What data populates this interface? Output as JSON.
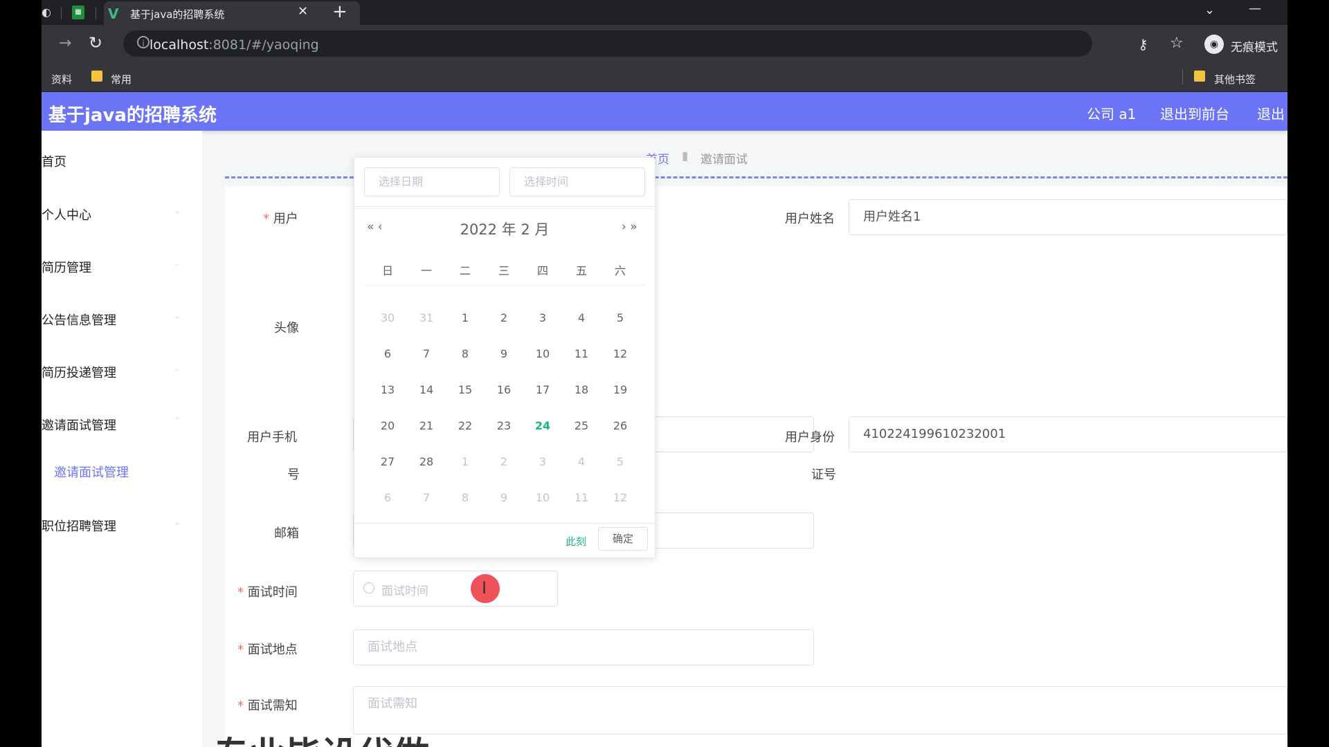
{
  "browser": {
    "tab_title": "基于java的招聘系统",
    "tab_close": "✕",
    "new_tab": "+",
    "url_host": "localhost",
    "url_rest": ":8081/#/yaoqing",
    "incognito_label": "无痕模式",
    "bookmarks": [
      "资料",
      "常用",
      "其他书签"
    ]
  },
  "header": {
    "title": "基于java的招聘系统",
    "company": "公司 a1",
    "back_to_front": "退出到前台",
    "logout": "退出"
  },
  "sidebar": {
    "items": [
      "首页",
      "个人中心",
      "简历管理",
      "公告信息管理",
      "简历投递管理",
      "邀请面试管理",
      "职位招聘管理"
    ],
    "sub_item": "邀请面试管理"
  },
  "breadcrumb": {
    "home": "首页",
    "current": "邀请面试"
  },
  "form": {
    "user_label": "用户",
    "username_label": "用户姓名",
    "username_value": "用户姓名1",
    "avatar_label": "头像",
    "phone_label_1": "用户手机",
    "phone_label_2": "号",
    "idcard_label_1": "用户身份",
    "idcard_label_2": "证号",
    "idcard_value": "410224199610232001",
    "email_label": "邮箱",
    "interview_time_label": "面试时间",
    "interview_time_placeholder": "面试时间",
    "interview_place_label": "面试地点",
    "interview_place_placeholder": "面试地点",
    "interview_notice_label": "面试需知",
    "interview_notice_placeholder": "面试需知",
    "required_mark": "*"
  },
  "datepicker": {
    "date_placeholder": "选择日期",
    "time_placeholder": "选择时间",
    "title": "2022 年  2 月",
    "prev": "« ‹",
    "next": "› »",
    "weekdays": [
      "日",
      "一",
      "二",
      "三",
      "四",
      "五",
      "六"
    ],
    "weeks": [
      [
        "30",
        "31",
        "1",
        "2",
        "3",
        "4",
        "5"
      ],
      [
        "6",
        "7",
        "8",
        "9",
        "10",
        "11",
        "12"
      ],
      [
        "13",
        "14",
        "15",
        "16",
        "17",
        "18",
        "19"
      ],
      [
        "20",
        "21",
        "22",
        "23",
        "24",
        "25",
        "26"
      ],
      [
        "27",
        "28",
        "1",
        "2",
        "3",
        "4",
        "5"
      ],
      [
        "6",
        "7",
        "8",
        "9",
        "10",
        "11",
        "12"
      ]
    ],
    "today": "24",
    "now_button": "此刻",
    "ok_button": "确定"
  },
  "overlay_text": "专业毕设代做",
  "colors": {
    "header": "#6b74f4",
    "accent": "#1bb38a",
    "required": "#f56c6c"
  }
}
